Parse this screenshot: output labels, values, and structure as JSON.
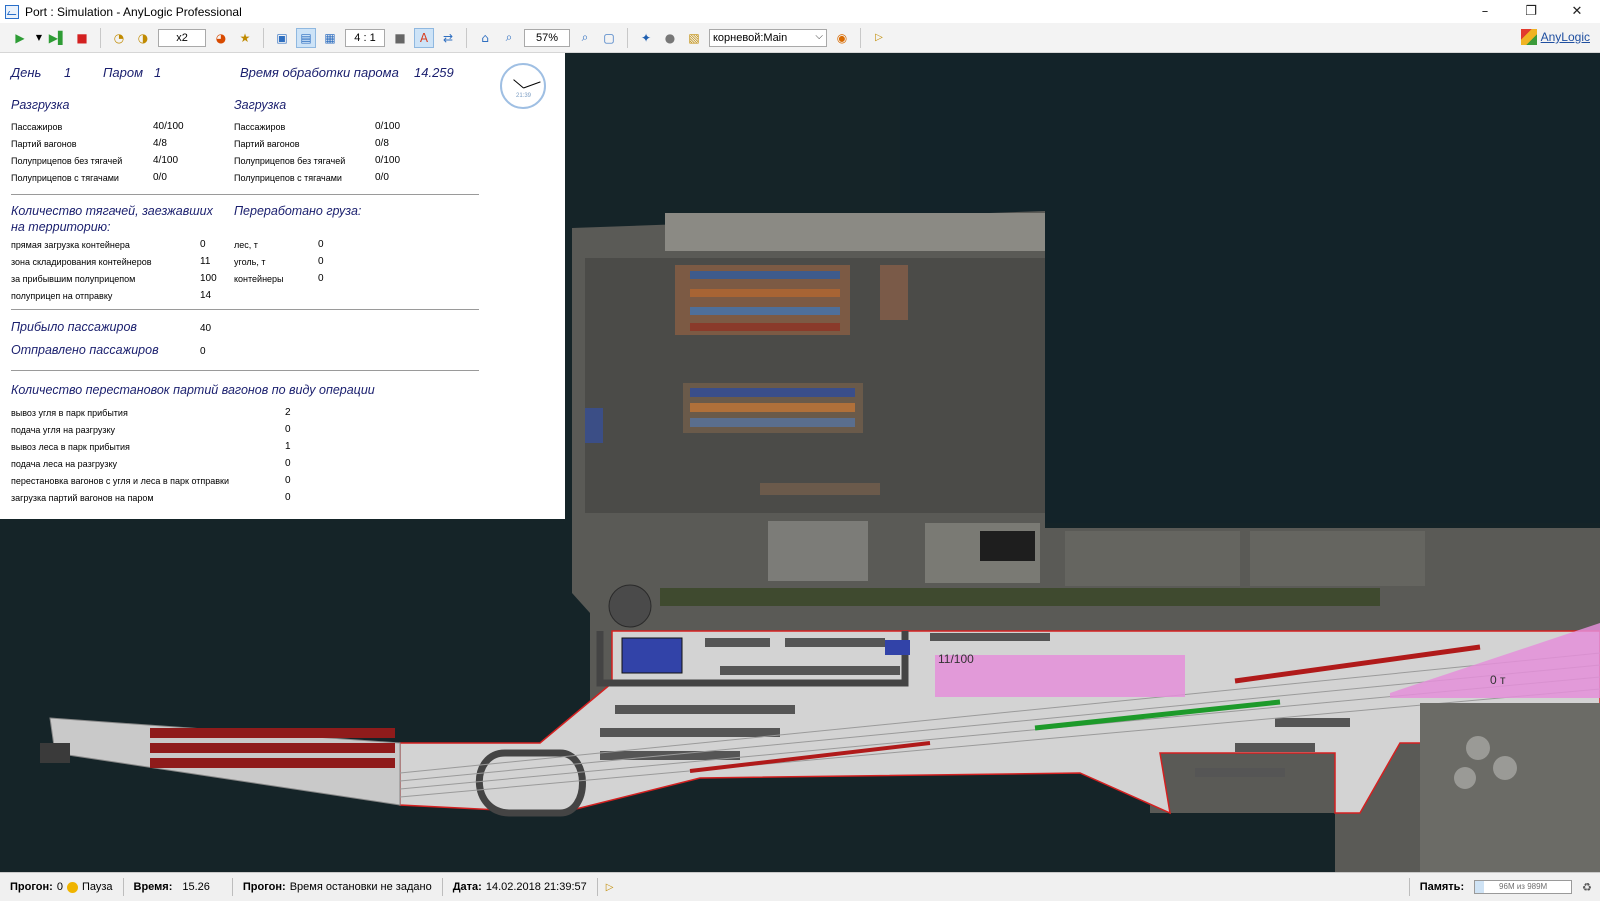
{
  "window": {
    "title": "Port : Simulation - AnyLogic Professional"
  },
  "toolbar": {
    "speed": "x2",
    "ratio": "4 : 1",
    "zoom": "57%",
    "view_select": "корневой:Main",
    "brand": "AnyLogic"
  },
  "info": {
    "day_label": "День",
    "day_value": "1",
    "ferry_label": "Паром",
    "ferry_value": "1",
    "processing_label": "Время обработки парома",
    "processing_value": "14.259",
    "clock_time": "21:39",
    "unloading": {
      "title": "Разгрузка",
      "rows": [
        {
          "label": "Пассажиров",
          "value": "40/100"
        },
        {
          "label": "Партий вагонов",
          "value": "4/8"
        },
        {
          "label": "Полуприцепов без тягачей",
          "value": "4/100"
        },
        {
          "label": "Полуприцепов с тягачами",
          "value": "0/0"
        }
      ]
    },
    "loading": {
      "title": "Загрузка",
      "rows": [
        {
          "label": "Пассажиров",
          "value": "0/100"
        },
        {
          "label": "Партий вагонов",
          "value": "0/8"
        },
        {
          "label": "Полуприцепов без тягачей",
          "value": "0/100"
        },
        {
          "label": "Полуприцепов с тягачами",
          "value": "0/0"
        }
      ]
    },
    "tractors": {
      "title_line1": "Количество тягачей, заезжавших",
      "title_line2": "на территорию:",
      "rows": [
        {
          "label": "прямая загрузка контейнера",
          "value": "0"
        },
        {
          "label": "зона складирования контейнеров",
          "value": "11"
        },
        {
          "label": "за прибывшим полуприцепом",
          "value": "100"
        },
        {
          "label": "полуприцеп на отправку",
          "value": "14"
        }
      ]
    },
    "cargo": {
      "title": "Переработано груза:",
      "rows": [
        {
          "label": "лес, т",
          "value": "0"
        },
        {
          "label": "уголь, т",
          "value": "0"
        },
        {
          "label": "контейнеры",
          "value": "0"
        }
      ]
    },
    "arrived_label": "Прибыло пассажиров",
    "arrived_value": "40",
    "sent_label": "Отправлено пассажиров",
    "sent_value": "0",
    "permutations": {
      "title": "Количество перестановок партий вагонов по виду операции",
      "rows": [
        {
          "label": "вывоз угля в парк прибытия",
          "value": "2"
        },
        {
          "label": "подача угля на разгрузку",
          "value": "0"
        },
        {
          "label": "вывоз леса в парк прибытия",
          "value": "1"
        },
        {
          "label": "подача леса на разгрузку",
          "value": "0"
        },
        {
          "label": "перестановка вагонов с угля и леса в парк отправки",
          "value": "0"
        },
        {
          "label": "загрузка партий вагонов на паром",
          "value": "0"
        }
      ]
    }
  },
  "map": {
    "counter_left": "11/100",
    "counter_right": "0 т"
  },
  "status": {
    "run_label": "Прогон:",
    "run_value": "0",
    "state": "Пауза",
    "time_label": "Время:",
    "time_value": "15.26",
    "run2_label": "Прогон:",
    "run2_value": "Время остановки не задано",
    "date_label": "Дата:",
    "date_value": "14.02.2018 21:39:57",
    "memory_label": "Память:",
    "memory_value": "96M из 989M",
    "memory_fraction": 0.097
  }
}
